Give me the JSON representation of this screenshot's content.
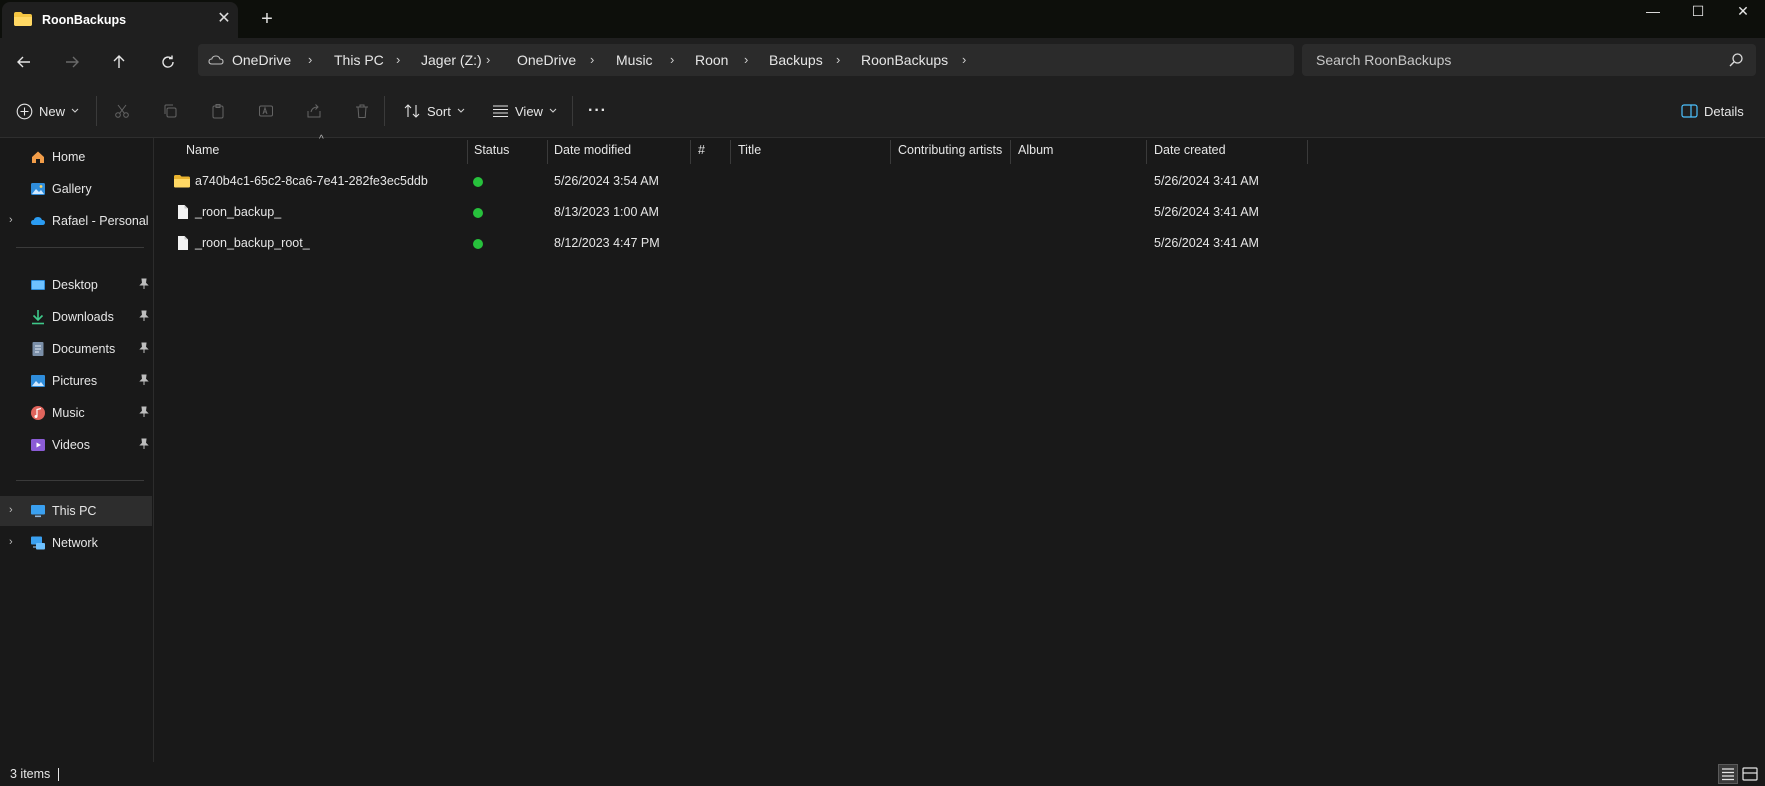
{
  "window": {
    "tab_title": "RoonBackups",
    "tab_close": "✕",
    "new_tab": "+",
    "minimize": "—",
    "maximize": "☐",
    "close": "✕"
  },
  "breadcrumb": [
    "OneDrive",
    "This PC",
    "Jager (Z:)",
    "OneDrive",
    "Music",
    "Roon",
    "Backups",
    "RoonBackups"
  ],
  "search": {
    "placeholder": "Search RoonBackups"
  },
  "toolbar": {
    "new_label": "New",
    "sort_label": "Sort",
    "view_label": "View",
    "more_label": "···",
    "details_label": "Details"
  },
  "sidebar": {
    "quick": [
      {
        "label": "Home",
        "icon": "home-icon"
      },
      {
        "label": "Gallery",
        "icon": "gallery-icon"
      },
      {
        "label": "Rafael - Personal",
        "icon": "onedrive-cloud-icon"
      }
    ],
    "pinned": [
      {
        "label": "Desktop",
        "icon": "desktop-icon"
      },
      {
        "label": "Downloads",
        "icon": "downloads-icon"
      },
      {
        "label": "Documents",
        "icon": "documents-icon"
      },
      {
        "label": "Pictures",
        "icon": "pictures-icon"
      },
      {
        "label": "Music",
        "icon": "music-icon"
      },
      {
        "label": "Videos",
        "icon": "videos-icon"
      }
    ],
    "system": [
      {
        "label": "This PC",
        "icon": "this-pc-icon"
      },
      {
        "label": "Network",
        "icon": "network-icon"
      }
    ]
  },
  "columns": {
    "name": "Name",
    "status": "Status",
    "date_modified": "Date modified",
    "number": "#",
    "title": "Title",
    "contributing_artists": "Contributing artists",
    "album": "Album",
    "date_created": "Date created"
  },
  "files": [
    {
      "name": "a740b4c1-65c2-8ca6-7e41-282fe3ec5ddb",
      "type": "folder",
      "date_modified": "5/26/2024 3:54 AM",
      "date_created": "5/26/2024 3:41 AM"
    },
    {
      "name": "_roon_backup_",
      "type": "file",
      "date_modified": "8/13/2023 1:00 AM",
      "date_created": "5/26/2024 3:41 AM"
    },
    {
      "name": "_roon_backup_root_",
      "type": "file",
      "date_modified": "8/12/2023 4:47 PM",
      "date_created": "5/26/2024 3:41 AM"
    }
  ],
  "statusbar": {
    "item_count": "3 items"
  },
  "colors": {
    "sync_ok": "#27c13c",
    "folder": "#f4c542",
    "accent": "#4cc2ff"
  }
}
